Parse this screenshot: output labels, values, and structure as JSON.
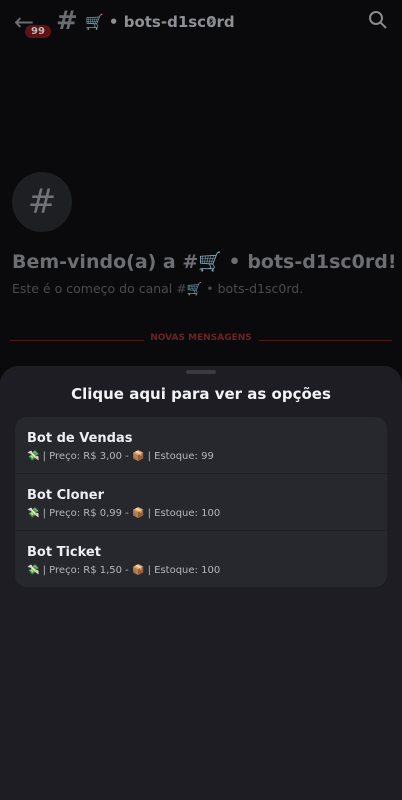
{
  "header": {
    "channel_title": "🛒 • bots-d1sc0rd",
    "badge_count": "99",
    "hash_symbol": "#"
  },
  "channel": {
    "welcome": "Bem-vindo(a) a #🛒 • bots-d1sc0rd!",
    "start_text": "Este é o começo do canal #🛒 • bots-d1sc0rd.",
    "new_messages_label": "NOVAS MENSAGENS"
  },
  "sheet": {
    "title": "Clique aqui para ver as opções",
    "options": [
      {
        "name": "Bot de Vendas",
        "description": "💸 | Preço: R$ 3,00 - 📦 | Estoque: 99"
      },
      {
        "name": "Bot Cloner",
        "description": "💸 | Preço: R$ 0,99 - 📦 | Estoque: 100"
      },
      {
        "name": "Bot Ticket",
        "description": "💸 | Preço: R$ 1,50 - 📦 | Estoque: 100"
      }
    ]
  },
  "colors": {
    "sheet_bg": "#1d1d23",
    "options_bg": "#27282e",
    "badge_bg": "#5e1416"
  }
}
